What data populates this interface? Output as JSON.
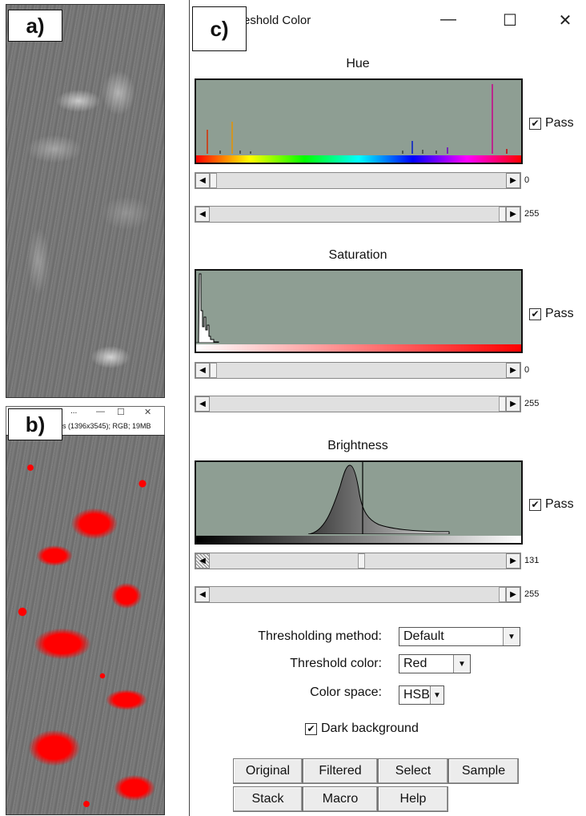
{
  "panels": {
    "a_label": "a)",
    "b_label": "b)",
    "c_label": "c)"
  },
  "image_b_window": {
    "title_fragment": "...",
    "subtitle": "s (1396x3545); RGB; 19MB",
    "controls": [
      "—",
      "☐",
      "✕"
    ]
  },
  "window": {
    "title": "reshold Color",
    "minimize": "—",
    "maximize": "☐",
    "close": "✕"
  },
  "hue": {
    "title": "Hue",
    "pass_label": "Pass",
    "pass_checked": "✔",
    "min_value": "0",
    "max_value": "255",
    "min_level": 0,
    "max_level": 255
  },
  "saturation": {
    "title": "Saturation",
    "pass_label": "Pass",
    "pass_checked": "✔",
    "min_value": "0",
    "max_value": "255",
    "min_level": 0,
    "max_level": 255
  },
  "brightness": {
    "title": "Brightness",
    "pass_label": "Pass",
    "pass_checked": "✔",
    "min_value": "131",
    "max_value": "255",
    "min_level": 131,
    "max_level": 255
  },
  "form": {
    "method_label": "Thresholding method:",
    "method_value": "Default",
    "color_label": "Threshold color:",
    "color_value": "Red",
    "space_label": "Color space:",
    "space_value": "HSB",
    "dark_bg_label": "Dark background",
    "dark_bg_checked": "✔"
  },
  "buttons": {
    "original": "Original",
    "filtered": "Filtered",
    "select": "Select",
    "sample": "Sample",
    "stack": "Stack",
    "macro": "Macro",
    "help": "Help"
  },
  "colors": {
    "histogram_bg": "#8e9e93",
    "threshold_red": "#ff0000"
  },
  "icons": {
    "arrow_left": "◀",
    "arrow_right": "▶",
    "dropdown": "▼"
  }
}
